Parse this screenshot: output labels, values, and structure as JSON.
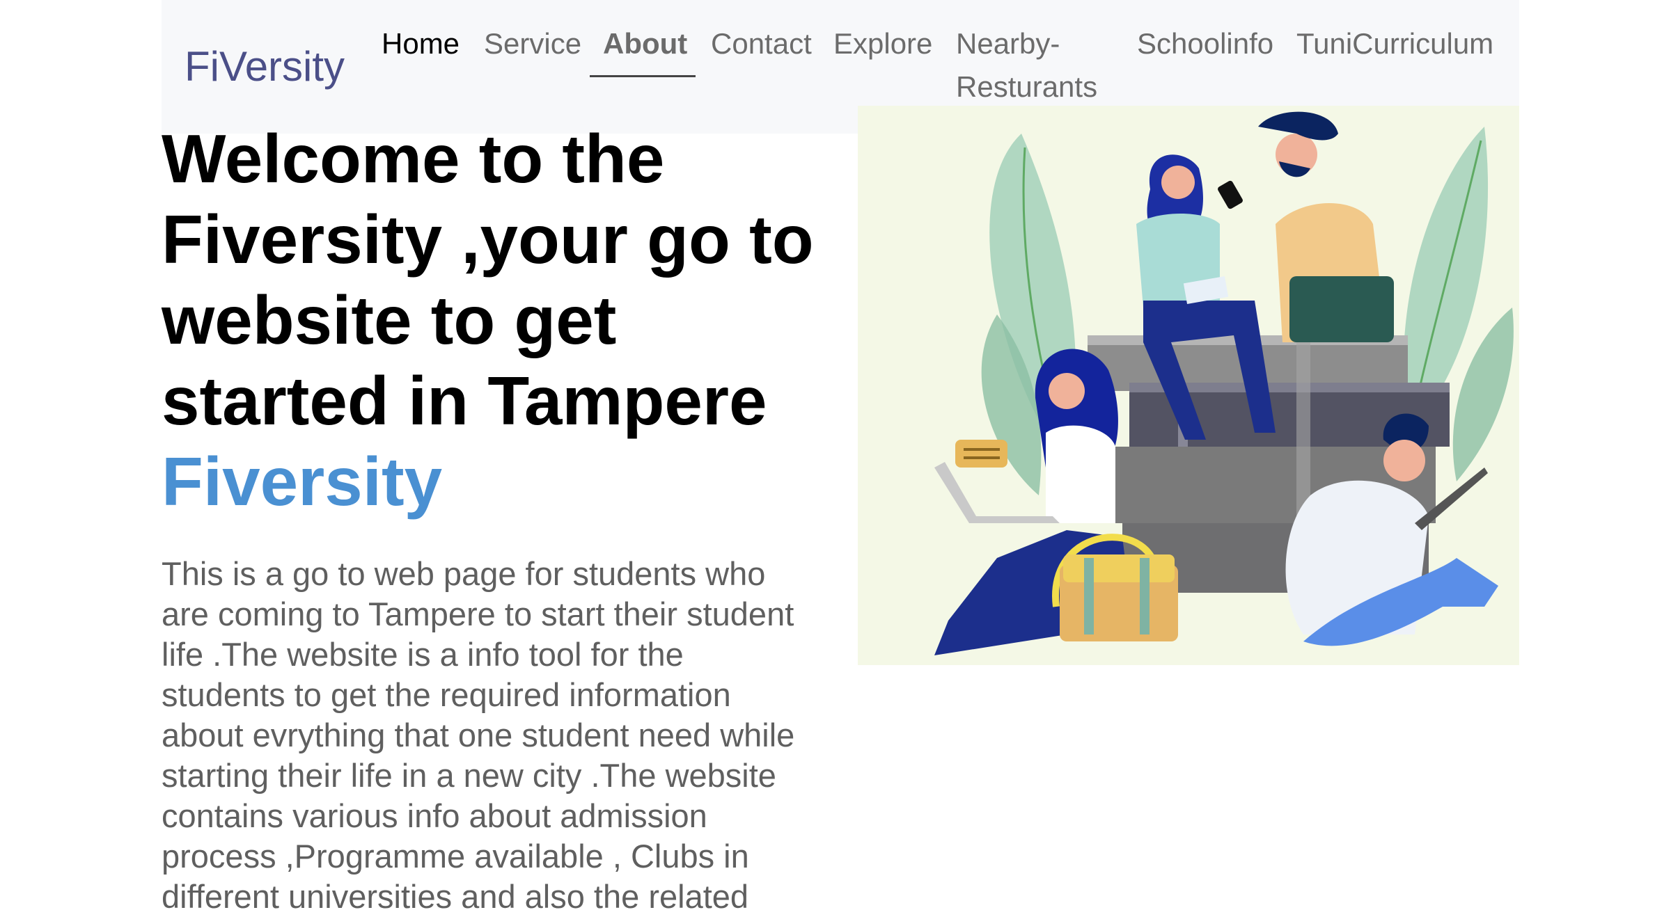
{
  "colors": {
    "brand": "#4b4f88",
    "nav_link": "#6b6b6b",
    "nav_active": "#000000",
    "accent": "#4a90d2",
    "body_text": "#5f5f5f",
    "illustration_bg": "#f4f8e6"
  },
  "navbar": {
    "brand": "FiVersity",
    "links": [
      {
        "label": "Home"
      },
      {
        "label": "Service"
      },
      {
        "label": "About"
      },
      {
        "label": "Contact"
      },
      {
        "label": "Explore"
      },
      {
        "label_line1": "Nearby-",
        "label_line2": "Resturants"
      },
      {
        "label": "Schoolinfo"
      },
      {
        "label": "TuniCurriculum"
      }
    ]
  },
  "hero": {
    "title_lines": [
      "Welcome to the",
      "Fiversity ,your go to",
      "website to get",
      "started in Tampere"
    ],
    "accent_word": "Fiversity",
    "paragraph_lines": [
      "This is a go to web page for students who",
      "are coming to Tampere to start their student",
      "life .The website is a info tool for the",
      "students to get the required information",
      "about evrything that one student need while",
      "starting their life in a new city .The website",
      "contains various info about admission",
      "process ,Programme available , Clubs in",
      "different universities and also the related"
    ]
  },
  "illustration": {
    "icon": "students-studying-illustration"
  }
}
